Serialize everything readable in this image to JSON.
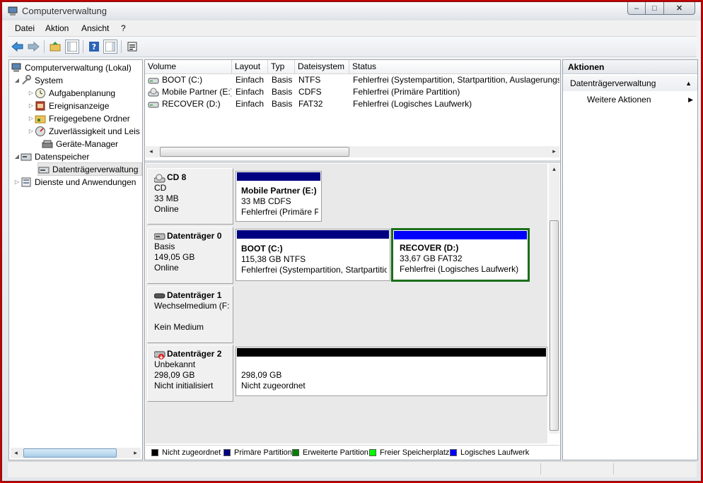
{
  "window": {
    "title": "Computerverwaltung"
  },
  "window_controls": {
    "minimize": "–",
    "maximize": "□",
    "close": "✕"
  },
  "menu": [
    "Datei",
    "Aktion",
    "Ansicht",
    "?"
  ],
  "toolbar_icons": [
    "back-icon",
    "forward-icon",
    "up-folder-icon",
    "show-hide-tree-icon",
    "help-icon",
    "console-view-icon",
    "properties-icon"
  ],
  "tree": {
    "root": "Computerverwaltung (Lokal)",
    "system": "System",
    "system_children": [
      "Aufgabenplanung",
      "Ereignisanzeige",
      "Freigegebene Ordner",
      "Zuverlässigkeit und Leis",
      "Geräte-Manager"
    ],
    "storage": "Datenspeicher",
    "storage_children": [
      "Datenträgerverwaltung"
    ],
    "services": "Dienste und Anwendungen"
  },
  "volume_table": {
    "columns": [
      "Volume",
      "Layout",
      "Typ",
      "Dateisystem",
      "Status"
    ],
    "rows": [
      {
        "volume": "BOOT (C:)",
        "layout": "Einfach",
        "typ": "Basis",
        "fs": "NTFS",
        "status": "Fehlerfrei (Systempartition, Startpartition, Auslagerungs"
      },
      {
        "volume": "Mobile Partner (E:)",
        "layout": "Einfach",
        "typ": "Basis",
        "fs": "CDFS",
        "status": "Fehlerfrei (Primäre Partition)"
      },
      {
        "volume": "RECOVER (D:)",
        "layout": "Einfach",
        "typ": "Basis",
        "fs": "FAT32",
        "status": "Fehlerfrei (Logisches Laufwerk)"
      }
    ]
  },
  "disks": [
    {
      "name": "CD 8",
      "kind": "CD",
      "size": "33 MB",
      "state": "Online",
      "empty": "",
      "partitions": [
        {
          "name": "Mobile Partner  (E:)",
          "size": "33 MB CDFS",
          "status": "Fehlerfrei (Primäre P",
          "color": "#000080"
        }
      ]
    },
    {
      "name": "Datenträger 0",
      "kind": "Basis",
      "size": "149,05 GB",
      "state": "Online",
      "empty": "",
      "partitions": [
        {
          "name": "BOOT  (C:)",
          "size": "115,38 GB NTFS",
          "status": "Fehlerfrei (Systempartition, Startpartitio",
          "color": "#000080"
        },
        {
          "name": "RECOVER  (D:)",
          "size": "33,67 GB FAT32",
          "status": "Fehlerfrei (Logisches Laufwerk)",
          "color": "#0000ff"
        }
      ]
    },
    {
      "name": "Datenträger 1",
      "kind": "Wechselmedium (F:",
      "size": "",
      "state": "Kein Medium",
      "empty": "",
      "partitions": []
    },
    {
      "name": "Datenträger 2",
      "kind": "Unbekannt",
      "size": "298,09 GB",
      "state": "Nicht initialisiert",
      "empty": "",
      "partitions": [
        {
          "name": "",
          "size": "298,09 GB",
          "status": "Nicht zugeordnet",
          "color": "#000000"
        }
      ]
    }
  ],
  "legend": [
    {
      "label": "Nicht zugeordnet",
      "color": "#000000"
    },
    {
      "label": "Primäre Partition",
      "color": "#000080"
    },
    {
      "label": "Erweiterte Partition",
      "color": "#008000"
    },
    {
      "label": "Freier Speicherplatz",
      "color": "#00ff00"
    },
    {
      "label": "Logisches Laufwerk",
      "color": "#0000ff"
    }
  ],
  "actions": {
    "header": "Aktionen",
    "section": "Datenträgerverwaltung",
    "more": "Weitere Aktionen"
  },
  "colors": {
    "selection_border": "#1a6e1a",
    "window_frame": "#c00000"
  }
}
